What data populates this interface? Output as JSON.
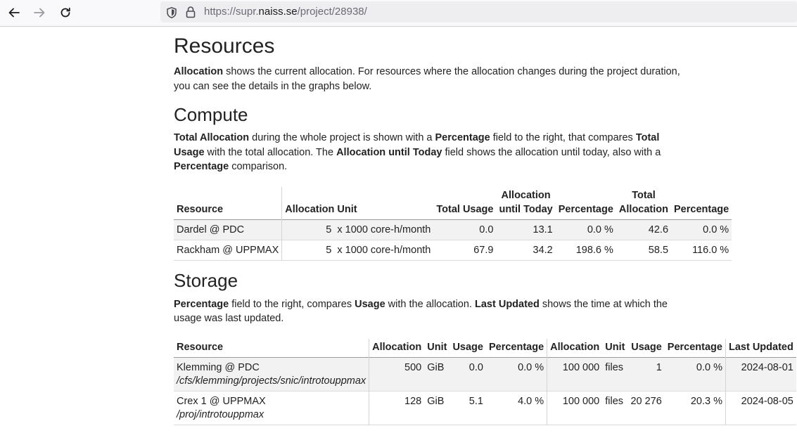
{
  "browser": {
    "url_prefix": "https://supr.",
    "url_host": "naiss.se",
    "url_path": "/project/28938/"
  },
  "resources": {
    "title": "Resources",
    "intro_bold": "Allocation",
    "intro_rest": " shows the current allocation. For resources where the allocation changes during the project duration, you can see the details in the graphs below."
  },
  "compute": {
    "title": "Compute",
    "desc": {
      "b1": "Total Allocation",
      "t1": " during the whole project is shown with a ",
      "b2": "Percentage",
      "t2": " field to the right, that compares ",
      "b3": "Total Usage",
      "t3": " with the total allocation. The ",
      "b4": "Allocation until Today",
      "t4": " field shows the allocation until today, also with a ",
      "b5": "Percentage",
      "t5": " comparison."
    },
    "headers": {
      "resource": "Resource",
      "allocation": "Allocation",
      "unit": "Unit",
      "total_usage": "Total Usage",
      "alloc_today_1": "Allocation",
      "alloc_today_2": "until Today",
      "percentage1": "Percentage",
      "total_alloc_1": "Total",
      "total_alloc_2": "Allocation",
      "percentage2": "Percentage"
    },
    "rows": [
      {
        "resource": "Dardel @ PDC",
        "allocation": "5",
        "unit": "x 1000 core-h/month",
        "total_usage": "0.0",
        "alloc_today": "13.1",
        "pct1": "0.0 %",
        "total_alloc": "42.6",
        "pct2": "0.0 %"
      },
      {
        "resource": "Rackham @ UPPMAX",
        "allocation": "5",
        "unit": "x 1000 core-h/month",
        "total_usage": "67.9",
        "alloc_today": "34.2",
        "pct1": "198.6 %",
        "total_alloc": "58.5",
        "pct2": "116.0 %"
      }
    ]
  },
  "storage": {
    "title": "Storage",
    "desc": {
      "b1": "Percentage",
      "t1": " field to the right, compares ",
      "b2": "Usage",
      "t2": " with the allocation. ",
      "b3": "Last Updated",
      "t3": " shows the time at which the usage was last updated."
    },
    "headers": {
      "resource": "Resource",
      "allocation": "Allocation",
      "unit": "Unit",
      "usage": "Usage",
      "percentage": "Percentage",
      "allocation2": "Allocation",
      "unit2": "Unit",
      "usage2": "Usage",
      "percentage2": "Percentage",
      "last_updated": "Last Updated"
    },
    "rows": [
      {
        "resource": "Klemming @ PDC",
        "path": "/cfs/klemming/projects/snic/introtouppmax",
        "allocation": "500",
        "unit": "GiB",
        "usage": "0.0",
        "pct": "0.0 %",
        "allocation2": "100 000",
        "unit2": "files",
        "usage2": "1",
        "pct2": "0.0 %",
        "last_updated": "2024-08-01"
      },
      {
        "resource": "Crex 1 @ UPPMAX",
        "path": "/proj/introtouppmax",
        "allocation": "128",
        "unit": "GiB",
        "usage": "5.1",
        "pct": "4.0 %",
        "allocation2": "100 000",
        "unit2": "files",
        "usage2": "20 276",
        "pct2": "20.3 %",
        "last_updated": "2024-08-05"
      }
    ]
  },
  "icons": {
    "back": "arrow-left-icon",
    "forward": "arrow-right-icon",
    "reload": "reload-icon",
    "shield": "shield-icon",
    "lock": "lock-icon"
  }
}
